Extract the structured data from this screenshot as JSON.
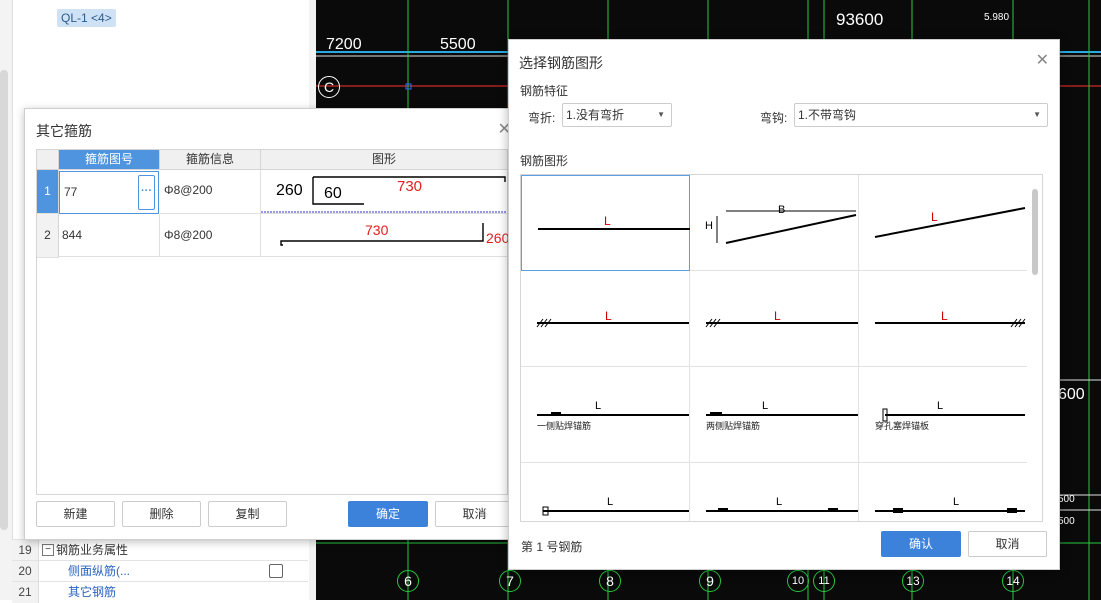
{
  "left_panel": {
    "tag": "QL-1 <4>",
    "rows": [
      {
        "num": "19",
        "label": "钢筋业务属性"
      },
      {
        "num": "20",
        "label": "侧面纵筋(..."
      },
      {
        "num": "21",
        "label": "其它钢筋"
      }
    ]
  },
  "cad": {
    "texts": [
      "7200",
      "5500",
      "93600",
      "5.980",
      "5.980",
      "500",
      "500",
      "5500",
      "600"
    ],
    "axis_top": [
      "C"
    ],
    "axis_bottom": [
      "6",
      "7",
      "8",
      "9",
      "10",
      "11",
      "13",
      "14"
    ]
  },
  "dialog1": {
    "title": "其它箍筋",
    "headers": [
      "箍筋图号",
      "箍筋信息",
      "图形"
    ],
    "rows": [
      {
        "num": "1",
        "code": "77",
        "info": "Φ8@200",
        "shape": {
          "a": "260",
          "b": "60",
          "c": "730"
        }
      },
      {
        "num": "2",
        "code": "844",
        "info": "Φ8@200",
        "shape": {
          "c": "730",
          "d": "260"
        }
      }
    ],
    "buttons": {
      "new": "新建",
      "delete": "删除",
      "copy": "复制",
      "ok": "确定",
      "cancel": "取消"
    }
  },
  "dialog2": {
    "title": "选择钢筋图形",
    "feature_label": "钢筋特征",
    "bend_label": "弯折:",
    "bend_value": "1.没有弯折",
    "hook_label": "弯钩:",
    "hook_value": "1.不带弯钩",
    "shapes_label": "钢筋图形",
    "shape_labels": {
      "L": "L",
      "B": "B",
      "H": "H"
    },
    "cell_notes": [
      "一侧贴焊锚筋",
      "两侧贴焊锚筋",
      "穿孔塞焊锚板"
    ],
    "status": "第 1 号钢筋",
    "ok": "确认",
    "cancel": "取消"
  }
}
